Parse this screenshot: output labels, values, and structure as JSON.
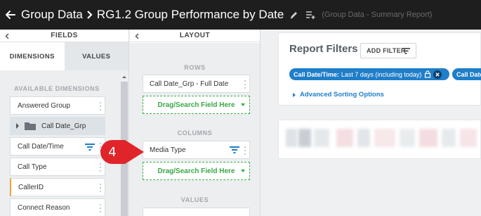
{
  "header": {
    "crumb_root": "Group Data",
    "crumb_current": "RG1.2 Group Performance by Date",
    "subtitle": "(Group Data - Summary Report)"
  },
  "fields_panel": {
    "title": "FIELDS",
    "tabs": [
      {
        "label": "DIMENSIONS",
        "active": true
      },
      {
        "label": "VALUES",
        "active": false
      }
    ],
    "available_title": "AVAILABLE DIMENSIONS",
    "items": [
      {
        "label": "Answered Group"
      },
      {
        "label": "Call Date_Grp",
        "type": "folder"
      },
      {
        "label": "Call Date/Time",
        "has_filter": true
      },
      {
        "label": "Call Type"
      },
      {
        "label": "CallerID",
        "highlight_color": "#f2a13a"
      },
      {
        "label": "Connect Reason"
      }
    ]
  },
  "layout_panel": {
    "title": "LAYOUT",
    "rows_title": "ROWS",
    "rows_item": "Call Date_Grp - Full Date",
    "drop_label": "Drag/Search Field Here",
    "columns_title": "COLUMNS",
    "columns_item": "Media Type",
    "values_title": "VALUES"
  },
  "callout": {
    "number": "4",
    "color": "#e0252a"
  },
  "report": {
    "filters_title": "Report Filters",
    "add_filter_label": "ADD FILTER",
    "chips": [
      {
        "bold": "Call Date/Time:",
        "text": "Last 7 days (including today)"
      },
      {
        "bold": "Call Date",
        "text": ""
      }
    ],
    "advanced_sorting": "Advanced Sorting Options"
  },
  "colors": {
    "header_bg": "#1e1e1e",
    "accent_blue": "#1f7ec9",
    "drop_green": "#3aa847",
    "callout_red": "#e0252a"
  }
}
